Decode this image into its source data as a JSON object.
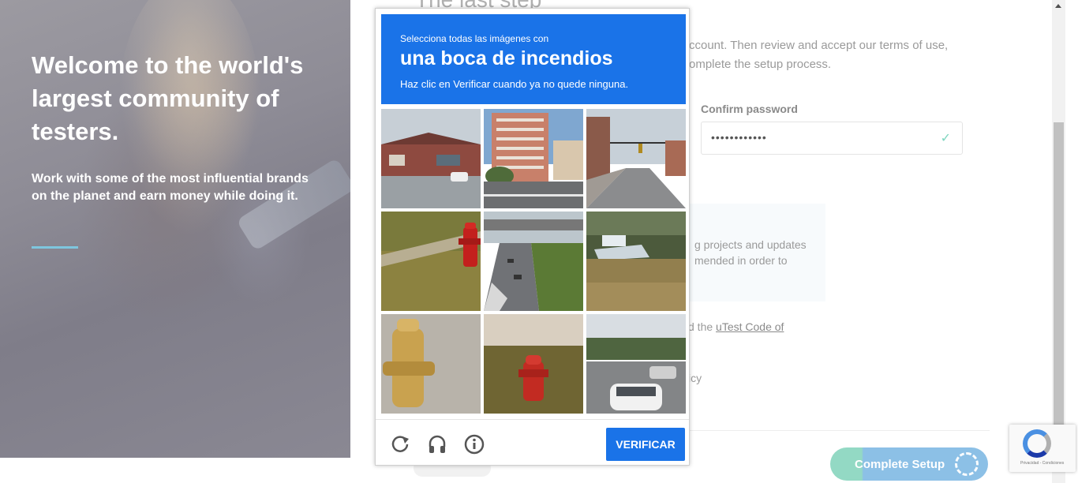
{
  "hero": {
    "title": "Welcome to the world's largest community of testers.",
    "subtitle": "Work with some of the most influential brands on the planet and earn money while doing it."
  },
  "form": {
    "step_title": "The last step",
    "intro": "ccount. Then review and accept our terms of use, omplete the setup process.",
    "confirm_password_label": "Confirm password",
    "confirm_password_value": "••••••••••••",
    "info_line1": "g projects and updates",
    "info_line2": "mended in order to",
    "terms_prefix": "d the ",
    "terms_link": "uTest Code of",
    "policy_fragment": "icy",
    "complete_button": "Complete Setup"
  },
  "captcha": {
    "instruction_top": "Selecciona todas las imágenes con",
    "target": "una boca de incendios",
    "instruction_bottom": "Haz clic en Verificar cuando ya no quede ninguna.",
    "verify_label": "VERIFICAR",
    "footer_icons": [
      "reload-icon",
      "audio-icon",
      "info-icon"
    ],
    "tiles": [
      {
        "name": "tile-building-parking"
      },
      {
        "name": "tile-apartment-tower"
      },
      {
        "name": "tile-street-traffic-light"
      },
      {
        "name": "tile-hydrant-red-grass"
      },
      {
        "name": "tile-highway-overpass"
      },
      {
        "name": "tile-boat-field"
      },
      {
        "name": "tile-hydrant-yellow"
      },
      {
        "name": "tile-hydrant-red-leaves"
      },
      {
        "name": "tile-road-cars"
      }
    ]
  },
  "recaptcha_badge": {
    "text": "Privacidad - Condiciones"
  },
  "colors": {
    "captcha_blue": "#1a73e8",
    "accent_teal": "#93d9c4",
    "accent_blue": "#8cc0e6",
    "hero_rule": "#7ec6de"
  }
}
